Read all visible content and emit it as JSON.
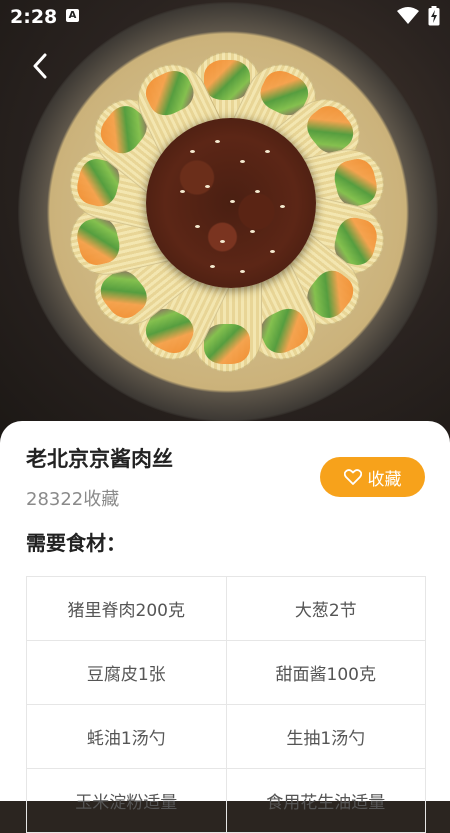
{
  "status_bar": {
    "time": "2:28",
    "notification_letter": "A"
  },
  "recipe": {
    "title": "老北京京酱肉丝",
    "favorites_count": "28322收藏",
    "favorite_button_label": "收藏",
    "ingredients_heading": "需要食材："
  },
  "ingredients": [
    [
      "猪里脊肉200克",
      "大葱2节"
    ],
    [
      "豆腐皮1张",
      "甜面酱100克"
    ],
    [
      "蚝油1汤勺",
      "生抽1汤勺"
    ],
    [
      "玉米淀粉适量",
      "食用花生油适量"
    ]
  ],
  "colors": {
    "accent": "#f7a21b"
  }
}
